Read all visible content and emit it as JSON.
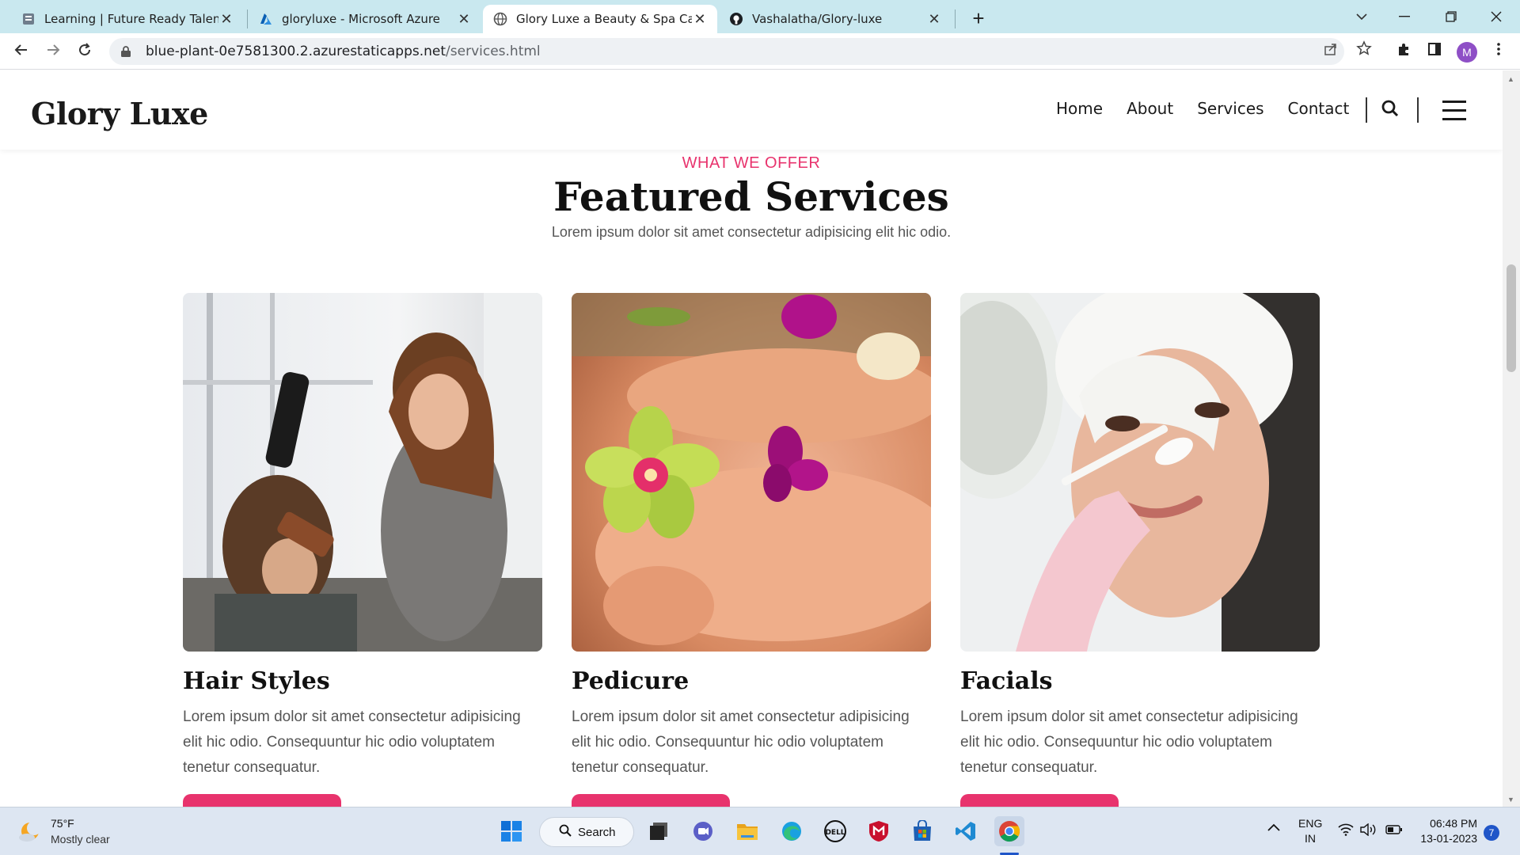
{
  "browser": {
    "tabs": [
      {
        "title": "Learning | Future Ready Talent",
        "icon": "learning-favicon"
      },
      {
        "title": "gloryluxe - Microsoft Azure",
        "icon": "azure-favicon"
      },
      {
        "title": "Glory Luxe a Beauty & Spa Categ",
        "icon": "globe-favicon",
        "active": true
      },
      {
        "title": "Vashalatha/Glory-luxe",
        "icon": "github-favicon"
      }
    ],
    "url_host": "blue-plant-0e7581300.2.azurestaticapps.net",
    "url_path": "/services.html",
    "profile_initial": "M"
  },
  "site": {
    "logo": "Glory Luxe",
    "nav": [
      "Home",
      "About",
      "Services",
      "Contact"
    ],
    "section": {
      "eyebrow": "WHAT WE OFFER",
      "title": "Featured Services",
      "subtitle": "Lorem ipsum dolor sit amet consectetur adipisicing elit hic odio."
    },
    "services": [
      {
        "title": "Hair Styles",
        "description": "Lorem ipsum dolor sit amet consectetur adipisicing elit hic odio. Consequuntur hic odio voluptatem tenetur consequatur."
      },
      {
        "title": "Pedicure",
        "description": "Lorem ipsum dolor sit amet consectetur adipisicing elit hic odio. Consequuntur hic odio voluptatem tenetur consequatur."
      },
      {
        "title": "Facials",
        "description": "Lorem ipsum dolor sit amet consectetur adipisicing elit hic odio. Consequuntur hic odio voluptatem tenetur consequatur."
      }
    ],
    "accent_color": "#e8336d"
  },
  "taskbar": {
    "weather_temp": "75°F",
    "weather_desc": "Mostly clear",
    "search_label": "Search",
    "lang_top": "ENG",
    "lang_bottom": "IN",
    "time": "06:48 PM",
    "date": "13-01-2023",
    "notification_count": "7"
  }
}
